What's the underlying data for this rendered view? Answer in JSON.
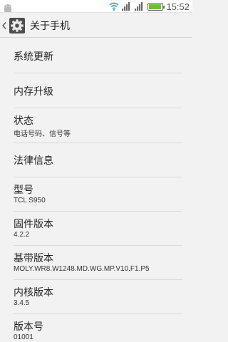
{
  "status_bar": {
    "time": "15:52",
    "battery_level_text": "",
    "icons": [
      "android-icon",
      "wifi-icon",
      "signal-icon",
      "signal-icon",
      "battery-icon"
    ]
  },
  "action_bar": {
    "title": "关于手机",
    "icon": "gear-icon"
  },
  "items": [
    {
      "title": "系统更新",
      "subtitle": ""
    },
    {
      "title": "内存升级",
      "subtitle": ""
    },
    {
      "title": "状态",
      "subtitle": "电话号码、信号等"
    },
    {
      "title": "法律信息",
      "subtitle": ""
    },
    {
      "title": "型号",
      "subtitle": "TCL S950"
    },
    {
      "title": "固件版本",
      "subtitle": "4.2.2"
    },
    {
      "title": "基带版本",
      "subtitle": "MOLY.WR8.W1248.MD.WG.MP.V10.F1.P5"
    },
    {
      "title": "内核版本",
      "subtitle": "3.4.5"
    },
    {
      "title": "版本号",
      "subtitle": "01001"
    }
  ],
  "colors": {
    "background": "#f2f2f2",
    "status_bar": "#ffffff",
    "accent_icon": "#3a3a3a",
    "battery_green": "#6bbf3a",
    "wifi_blue": "#2aa6e0"
  }
}
